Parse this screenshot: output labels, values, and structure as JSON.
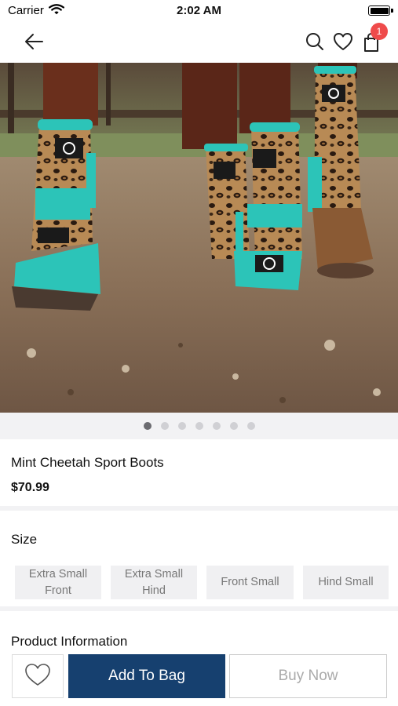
{
  "status_bar": {
    "carrier": "Carrier",
    "time": "2:02 AM"
  },
  "nav": {
    "cart_count": "1"
  },
  "gallery": {
    "image_count": 7,
    "active_index": 0
  },
  "product": {
    "name": "Mint Cheetah Sport Boots",
    "price": "$70.99"
  },
  "size": {
    "label": "Size",
    "options": [
      {
        "line1": "Extra Small",
        "line2": "Front"
      },
      {
        "line1": "Extra Small",
        "line2": "Hind"
      },
      {
        "line1": "Front Small",
        "line2": ""
      },
      {
        "line1": "Hind Small",
        "line2": ""
      }
    ]
  },
  "info": {
    "label": "Product Information"
  },
  "actions": {
    "add_to_bag": "Add To Bag",
    "buy_now": "Buy Now"
  },
  "colors": {
    "accent": "#16406f",
    "badge": "#ef4b4b",
    "boot_mint": "#2cc4b8"
  }
}
